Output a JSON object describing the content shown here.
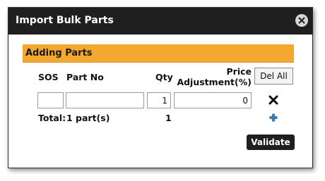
{
  "dialog": {
    "title": "Import Bulk Parts",
    "close_icon": "close-circle-icon"
  },
  "section": {
    "title": "Adding Parts",
    "accent_color": "#f5a82f"
  },
  "table": {
    "headers": {
      "sos": "SOS",
      "part_no": "Part No",
      "qty": "Qty",
      "price_line1": "Price",
      "price_line2": "Adjustment(%)"
    },
    "del_all_label": "Del All",
    "row": {
      "sos": "",
      "part_no": "",
      "qty": "1",
      "price_adjustment": "0",
      "delete_icon": "x-icon"
    },
    "total": {
      "label": "Total:",
      "value": "1 part(s)",
      "qty": "1",
      "add_icon": "plus-icon"
    }
  },
  "actions": {
    "validate_label": "Validate"
  }
}
